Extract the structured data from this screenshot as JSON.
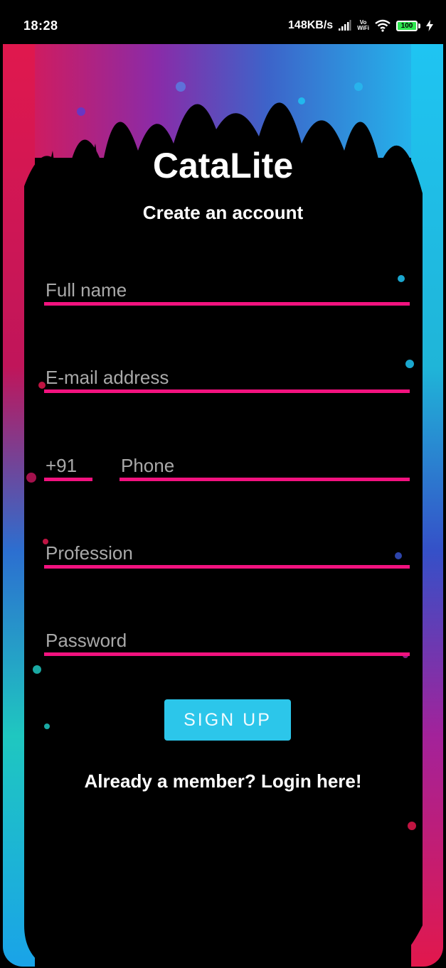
{
  "status_bar": {
    "time": "18:28",
    "network_speed": "148KB/s",
    "vowifi_top": "Vo",
    "vowifi_bottom": "WiFi",
    "battery_level": "100",
    "icons": [
      "signal-bars-icon",
      "vowifi-icon",
      "wifi-icon",
      "battery-icon",
      "charging-bolt-icon"
    ]
  },
  "app": {
    "title": "CataLite",
    "subtitle": "Create an account"
  },
  "form": {
    "full_name": {
      "value": "",
      "placeholder": "Full name"
    },
    "email": {
      "value": "",
      "placeholder": "E-mail address"
    },
    "country_code": {
      "value": "+91",
      "placeholder": ""
    },
    "phone": {
      "value": "",
      "placeholder": "Phone"
    },
    "profession": {
      "value": "",
      "placeholder": "Profession"
    },
    "password": {
      "value": "",
      "placeholder": "Password"
    },
    "signup_label": "SIGN UP",
    "login_prompt": "Already a member? Login here!"
  },
  "colors": {
    "underline": "#f2127f",
    "button": "#2cc6ea",
    "background": "#000000",
    "splash_gradient": [
      "#e0184e",
      "#3a2fb0",
      "#22b6f0"
    ]
  }
}
